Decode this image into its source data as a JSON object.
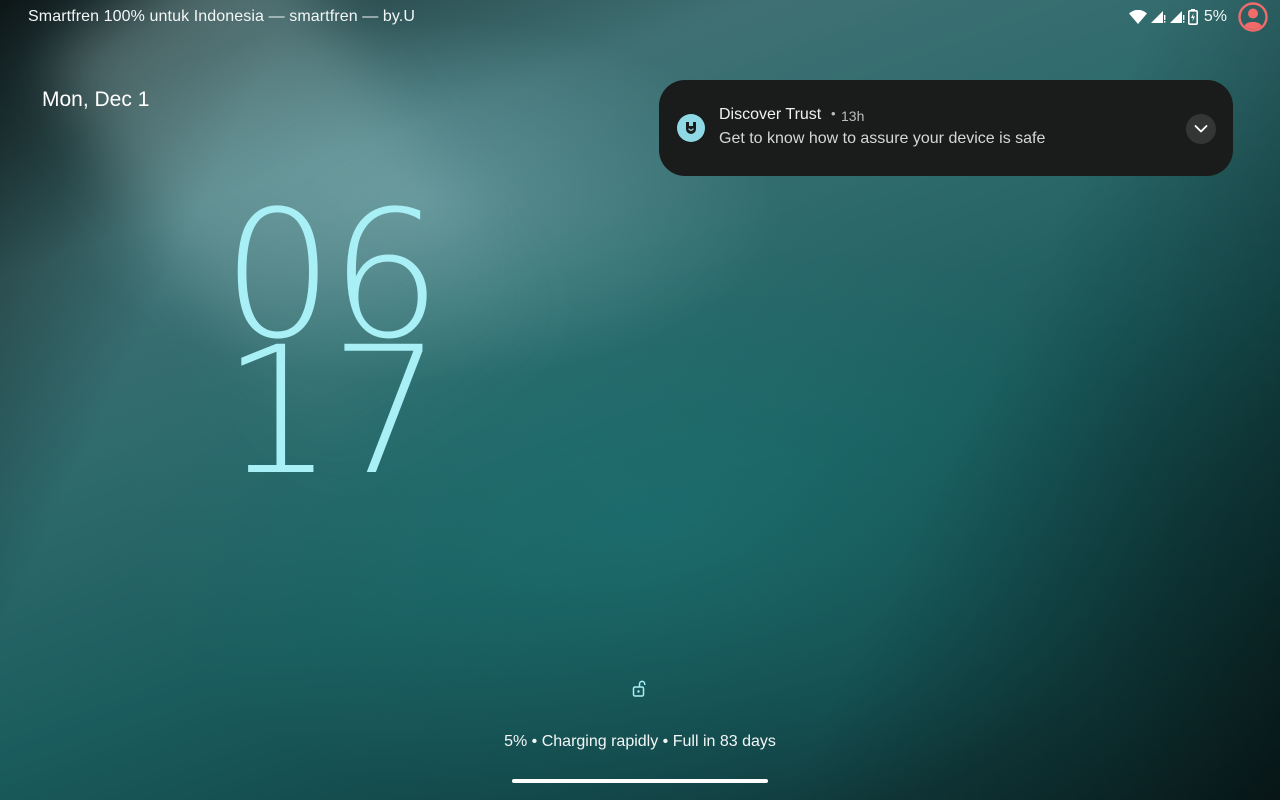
{
  "status_bar": {
    "carrier_text": "Smartfren 100% untuk Indonesia — smartfren — by.U",
    "battery_percent": "5%",
    "icons": [
      "wifi-icon",
      "signal-icon",
      "signal-icon",
      "battery-charging-icon",
      "user-avatar-icon"
    ]
  },
  "lockscreen": {
    "date": "Mon, Dec 1",
    "clock_hours": "06",
    "clock_minutes": "17",
    "charging_status": "5% • Charging rapidly • Full in 83 days"
  },
  "notification": {
    "app_name": "Discover Trust",
    "separator": "•",
    "time": "13h",
    "body": "Get to know how to assure your device is safe",
    "icon": "discover-trust-icon",
    "expand_icon": "chevron-down-icon"
  },
  "colors": {
    "clock": "#a8f0f6",
    "notification_bg": "#1a1b1b",
    "notification_icon_bg": "#8fd8e6",
    "avatar": "#f26b6b"
  }
}
